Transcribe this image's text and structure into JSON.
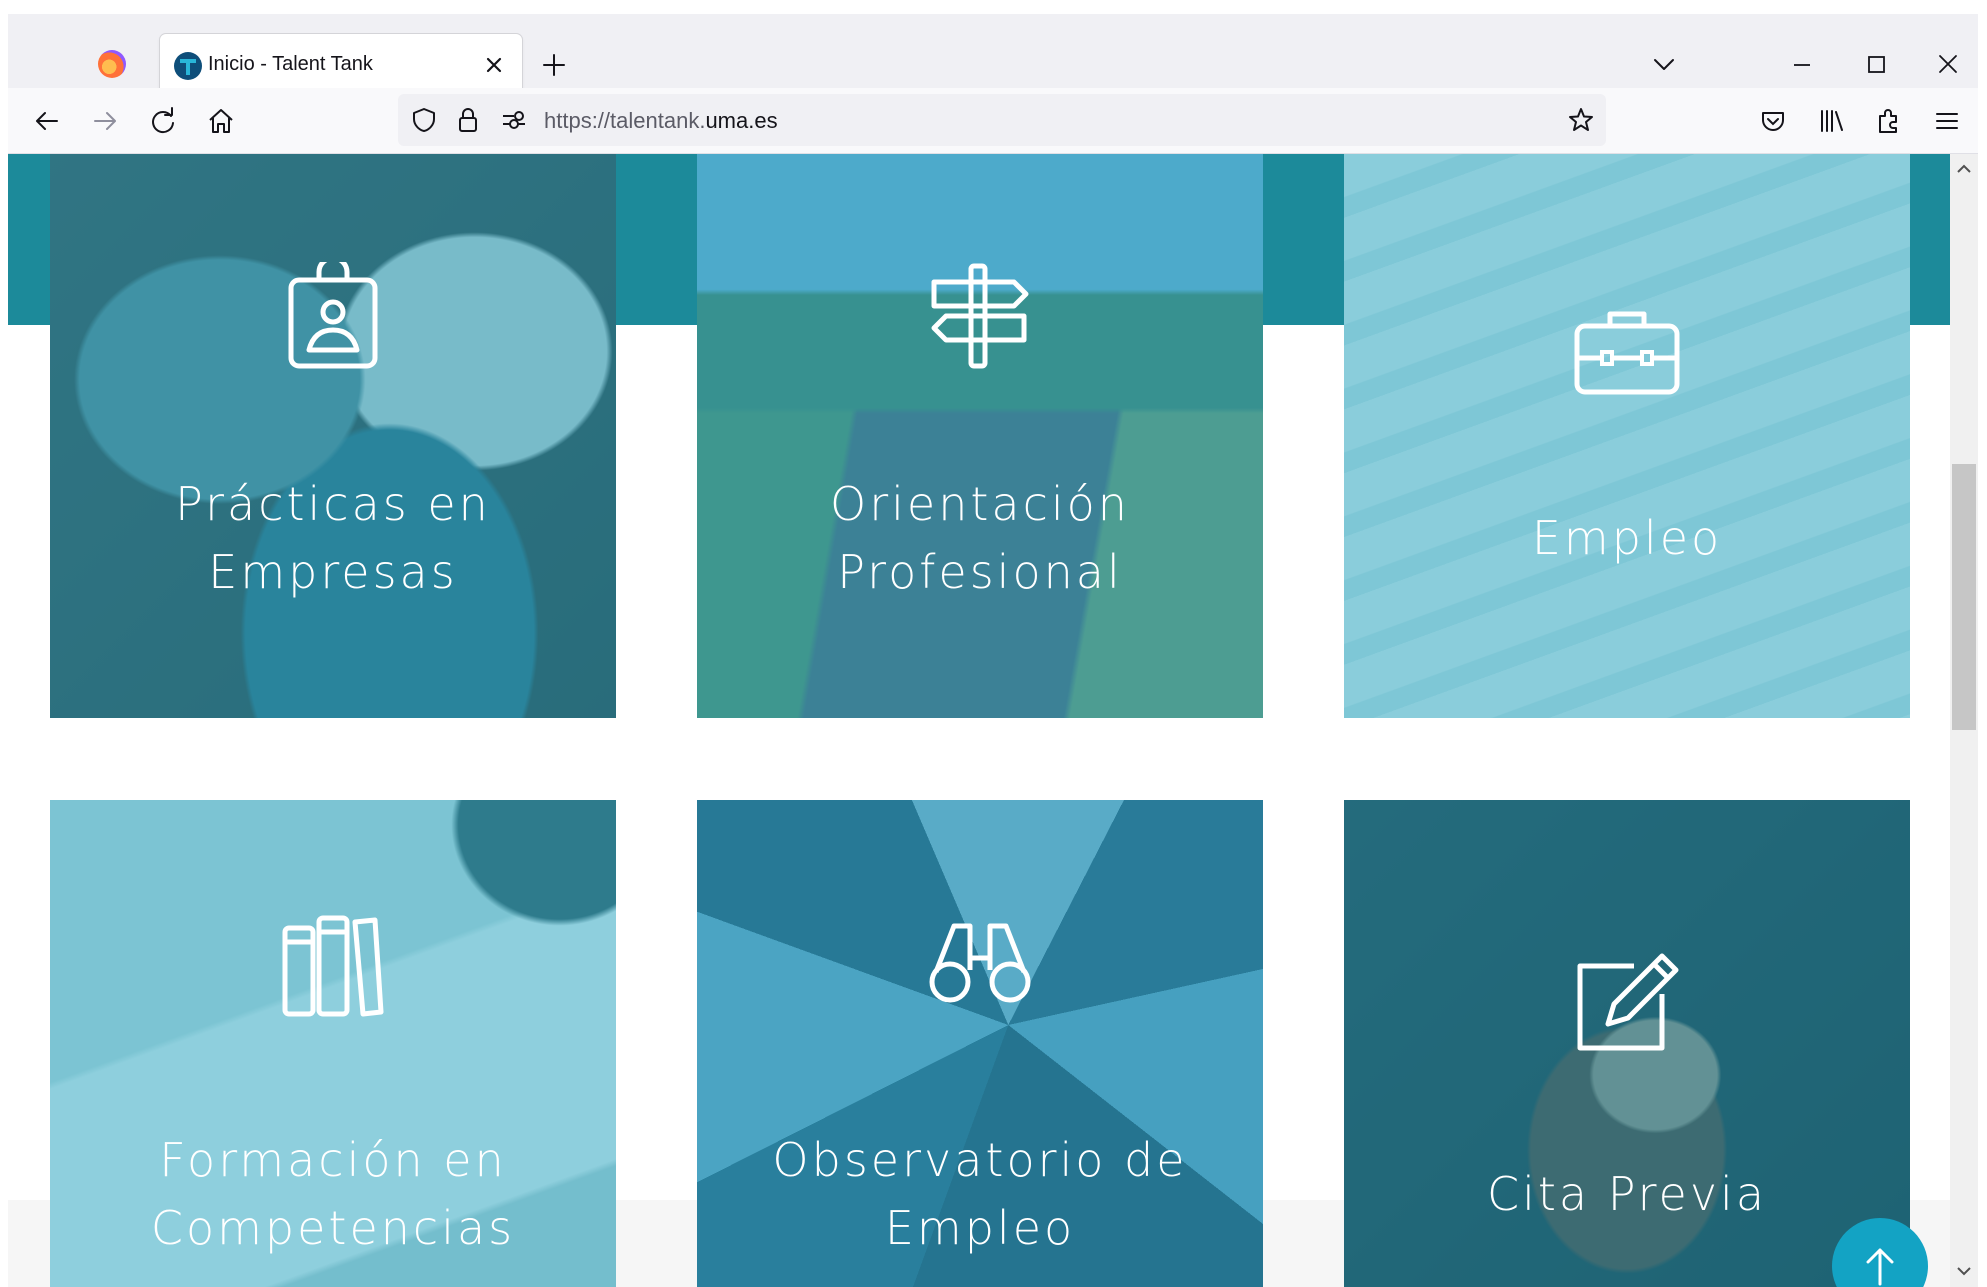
{
  "browser": {
    "tab": {
      "title": "Inicio - Talent Tank",
      "favicon": "talent-tank-favicon"
    },
    "url": {
      "prefix": "https://talentank.",
      "domain": "uma.es"
    },
    "icons": {
      "app": "firefox-icon",
      "back": "back-arrow-icon",
      "forward": "forward-arrow-icon",
      "reload": "reload-icon",
      "home": "home-icon",
      "shield": "tracking-shield-icon",
      "lock": "lock-icon",
      "permissions": "permissions-icon",
      "bookmark": "star-icon",
      "pocket": "pocket-icon",
      "library": "library-icon",
      "extensions": "extensions-icon",
      "menu": "hamburger-menu-icon"
    }
  },
  "cards": [
    {
      "line1": "Prácticas en",
      "line2": "Empresas",
      "icon": "id-badge-icon"
    },
    {
      "line1": "Orientación",
      "line2": "Profesional",
      "icon": "signpost-icon"
    },
    {
      "line1": "Empleo",
      "line2": "",
      "icon": "briefcase-icon"
    },
    {
      "line1": "Formación en",
      "line2": "Competencias",
      "icon": "books-icon"
    },
    {
      "line1": "Observatorio de",
      "line2": "Empleo",
      "icon": "binoculars-icon"
    },
    {
      "line1": "Cita Previa",
      "line2": "",
      "icon": "edit-pencil-icon"
    }
  ],
  "colors": {
    "accent": "#13a3c4",
    "teal_band": "#1c8a9a",
    "card_overlay": "#36a9c4"
  },
  "scroll_to_top": {
    "icon": "arrow-up-icon"
  }
}
